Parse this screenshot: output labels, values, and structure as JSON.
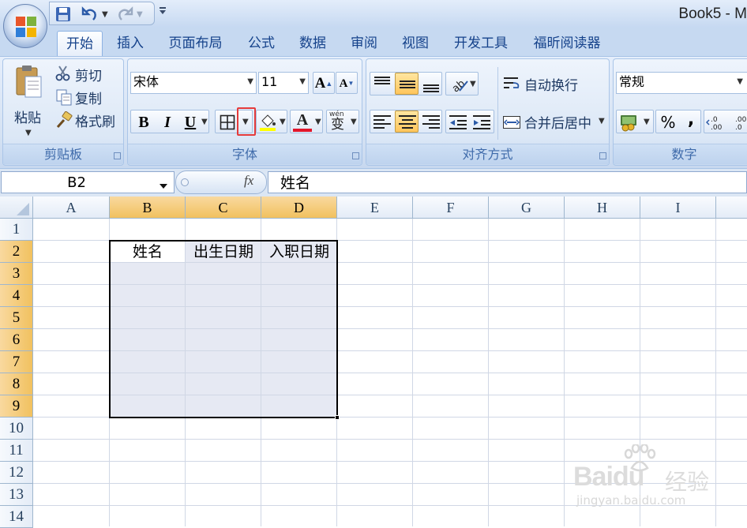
{
  "app": {
    "title": "Book5 - M"
  },
  "tabs": [
    "开始",
    "插入",
    "页面布局",
    "公式",
    "数据",
    "审阅",
    "视图",
    "开发工具",
    "福昕阅读器"
  ],
  "clipboard": {
    "paste_label": "粘贴",
    "cut_label": "剪切",
    "copy_label": "复制",
    "format_painter_label": "格式刷",
    "group_label": "剪贴板"
  },
  "font": {
    "font_name": "宋体",
    "font_size": "11",
    "grow": "A",
    "shrink": "A",
    "bold": "B",
    "italic": "I",
    "underline": "U",
    "font_color": "A",
    "phonetic": "wén",
    "phonetic_char": "变",
    "group_label": "字体"
  },
  "alignment": {
    "wrap_text_label": "自动换行",
    "merge_center_label": "合并后居中",
    "group_label": "对齐方式"
  },
  "number": {
    "format": "常规",
    "percent": "%",
    "comma": ",",
    "group_label": "数字"
  },
  "formula_bar": {
    "name_box": "B2",
    "fx": "fx",
    "value": "姓名"
  },
  "sheet": {
    "columns": [
      "A",
      "B",
      "C",
      "D",
      "E",
      "F",
      "G",
      "H",
      "I"
    ],
    "selected_columns": [
      "B",
      "C",
      "D"
    ],
    "rows": [
      "1",
      "2",
      "3",
      "4",
      "5",
      "6",
      "7",
      "8",
      "9",
      "10",
      "11",
      "12",
      "13",
      "14"
    ],
    "selected_rows": [
      "2",
      "3",
      "4",
      "5",
      "6",
      "7",
      "8",
      "9"
    ],
    "cells": {
      "B2": "姓名",
      "C2": "出生日期",
      "D2": "入职日期"
    }
  },
  "watermark": {
    "brand": "Baidu",
    "cn": "经验",
    "url": "jingyan.baidu.com"
  }
}
